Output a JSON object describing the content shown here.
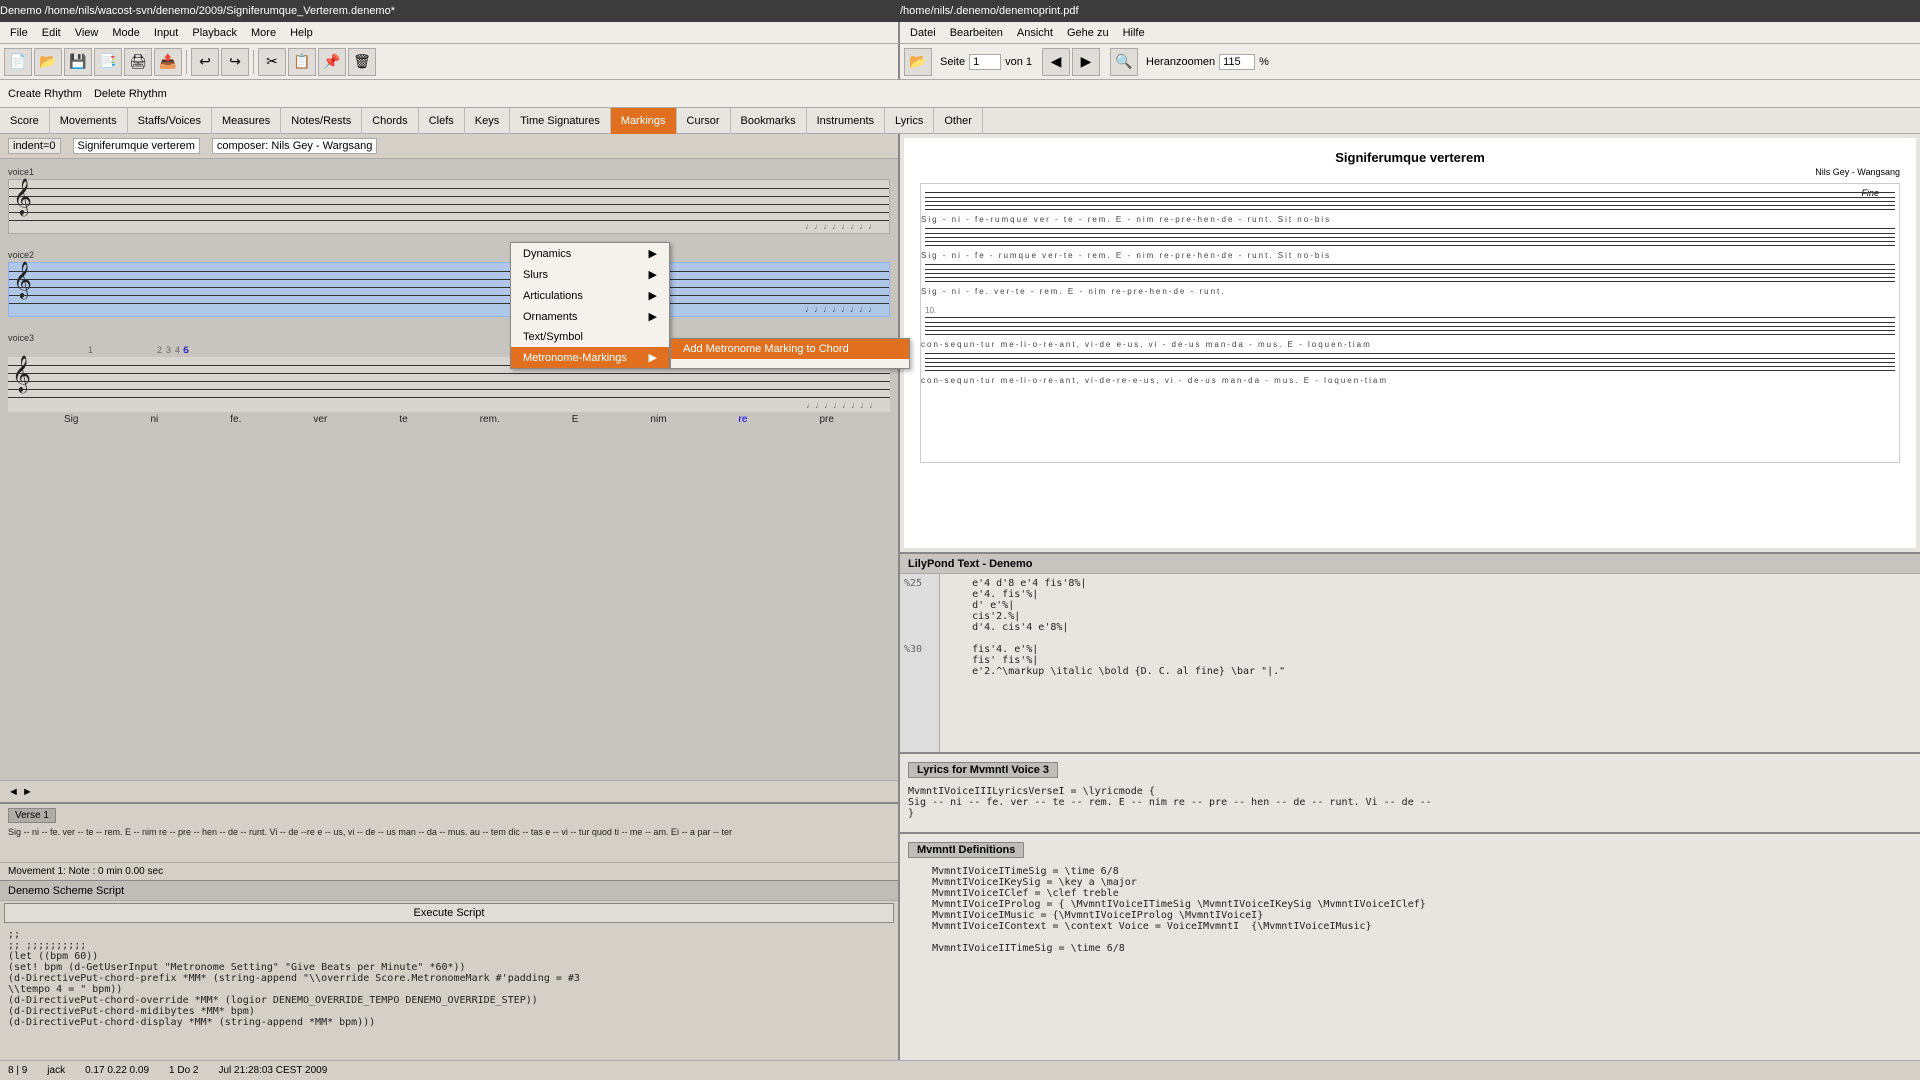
{
  "windows": {
    "left": {
      "title": "Denemo  /home/nils/wacost-svn/denemo/2009/Signiferumque_Verterem.denemo*"
    },
    "right": {
      "title": "/home/nils/.denemo/denemoprint.pdf"
    }
  },
  "left_menu": {
    "items": [
      "File",
      "Edit",
      "View",
      "Mode",
      "Input",
      "Playback",
      "More",
      "Help"
    ]
  },
  "right_menu": {
    "items": [
      "Datei",
      "Bearbeiten",
      "Ansicht",
      "Gehe zu",
      "Hilfe"
    ]
  },
  "toolbar_buttons": [
    "new",
    "open",
    "save",
    "save-pdf",
    "print",
    "export",
    "undo",
    "redo",
    "cut",
    "copy",
    "paste",
    "delete"
  ],
  "action_bar": {
    "create_rhythm": "Create Rhythm",
    "delete_rhythm": "Delete Rhythm"
  },
  "nav_tabs": {
    "items": [
      "Score",
      "Movements",
      "Staffs/Voices",
      "Measures",
      "Notes/Rests",
      "Chords",
      "Clefs",
      "Keys",
      "Time Signatures",
      "Markings",
      "Cursor",
      "Bookmarks",
      "Instruments",
      "Lyrics",
      "Other"
    ],
    "active": "Markings"
  },
  "markings_dropdown": {
    "items": [
      {
        "label": "Dynamics",
        "has_arrow": true
      },
      {
        "label": "Slurs",
        "has_arrow": true
      },
      {
        "label": "Articulations",
        "has_arrow": true
      },
      {
        "label": "Ornaments",
        "has_arrow": true
      },
      {
        "label": "Text/Symbol",
        "has_arrow": false
      },
      {
        "label": "Metronome-Markings",
        "has_arrow": true,
        "highlighted": true
      }
    ]
  },
  "metronome_submenu": {
    "items": [
      {
        "label": "Add Metronome Marking to Chord",
        "highlighted": true
      }
    ]
  },
  "score_area": {
    "indent": "indent=0",
    "title": "Signiferumque verterem",
    "composer": "composer: Nils Gey - Wargsang",
    "voices": [
      {
        "label": "voice1",
        "selected": false
      },
      {
        "label": "voice2",
        "selected": true
      },
      {
        "label": "voice3",
        "selected": false
      }
    ]
  },
  "verse_area": {
    "tab": "Verse 1",
    "text": "Sig -- ni -- fe. ver -- te -- rem. E -- nim re -- pre -- hen -- de -- runt. Vi -- de --re e -- us, vi -- de -- us man -- da -- mus.  au -- tem dic -- tas e -- vi -- tur quod ti -- me -- am. Ei -- a par -- ter"
  },
  "movement_status": {
    "text": "Movement 1: Note : 0 min 0.00 sec"
  },
  "script_area": {
    "title": "Denemo Scheme Script",
    "execute_btn": "Execute Script",
    "content": ";;\n;; ;;;;;;;;;;\n(let ((bpm 60))\n(set! bpm (d-GetUserInput \"Metronome Setting\" \"Give Beats per Minute\" *60*))\n(d-DirectivePut-chord-prefix *MM* (string-append \"\\\\override Score.MetronomeMark #'padding = #3\n\\\\tempo 4 = \" bpm))\n(d-DirectivePut-chord-override *MM* (logior DENEMO_OVERRIDE_TEMPO DENEMO_OVERRIDE_STEP))\n(d-DirectivePut-chord-midibytes *MM* bpm)\n(d-DirectivePut-chord-display *MM* (string-append *MM* bpm)))"
  },
  "pdf_viewer": {
    "title": "/home/nils/.denemo/denemoprint.pdf",
    "page_label": "Seite",
    "page_current": "1",
    "page_total": "von 1",
    "zoom_label": "Heranzoomen",
    "zoom_value": "115",
    "zoom_unit": "%",
    "prev_btn": "Vorherige Seite",
    "next_btn": "Nächste Seite",
    "open_btn": "Öffnen",
    "sheet": {
      "title": "Signiferumque verterem",
      "composer": "Nils Gey - Wangsang",
      "fine_label": "Fine",
      "lyrics_lines": [
        "Sig - ni - fe-rumque ver - te -    rem.  E - nim re-pre-hen-de -    runt.  Sit no-bis",
        "Sig - ni - fe - rumque ver-te - rem.   E - nim re-pre-hen-de -   runt.  Sit no-bis",
        "Sig - ni - fe.           ver-te -   rem.  E - nim re-pre-hen-de -  runt.",
        "con-sequn-tur me-li-o-re-ant,    vi-de e-us, vi - de-us man-da -   mus.  E - loquen-tiam",
        "con-sequn-tur me-li-o-re-ant,  vi-de-re-e-us, vi - de-us man-da -  mus.  E - loquen-tiam"
      ]
    }
  },
  "lily_panel": {
    "title": "LilyPond Text - Denemo",
    "line_numbers": [
      "%25",
      "",
      "",
      "",
      "",
      "",
      "%30",
      "",
      "",
      "",
      ""
    ],
    "content": "    e'4 d'8 e'4 fis'8%|\n    e'4. fis'%|\n    d' e'%|\n    cis'2.%|\n    d'4. cis'4 e'8%|\n\n    fis'4. e'%|\n    fis' fis'%|\n    e'2.^\\markup \\italic \\bold {D. C. al fine} \\bar \"|.\""
  },
  "lyrics_panel": {
    "title": "Lyrics for MvmntI Voice 3",
    "content": "MvmntIVoiceIIILyricsVerseI = \\lyricmode {\nSig -- ni -- fe. ver -- te -- rem. E -- nim re -- pre -- hen -- de -- runt. Vi -- de --\n}"
  },
  "defs_panel": {
    "title": "MvmntI Definitions",
    "content": "    MvmntIVoiceITimeSig = \\time 6/8\n    MvmntIVoiceIKeySig = \\key a \\major\n    MvmntIVoiceIClef = \\clef treble\n    MvmntIVoiceIProlog = { \\MvmntIVoiceITimeSig \\MvmntIVoiceIKeySig \\MvmntIVoiceIClef}\n    MvmntIVoiceIMusic = {\\MvmntIVoiceIProlog \\MvmntIVoiceI}\n    MvmntIVoiceIContext = \\context Voice = VoiceIMvmntI  {\\MvmntIVoiceIMusic}\n\n    MvmntIVoiceIITimeSig = \\time 6/8"
  },
  "bottom_bar": {
    "coords": "0.17 0.22 0.09",
    "position": "1 Do 2",
    "time": "Jul 21:28:03 CEST 2009",
    "jack": "jack"
  }
}
